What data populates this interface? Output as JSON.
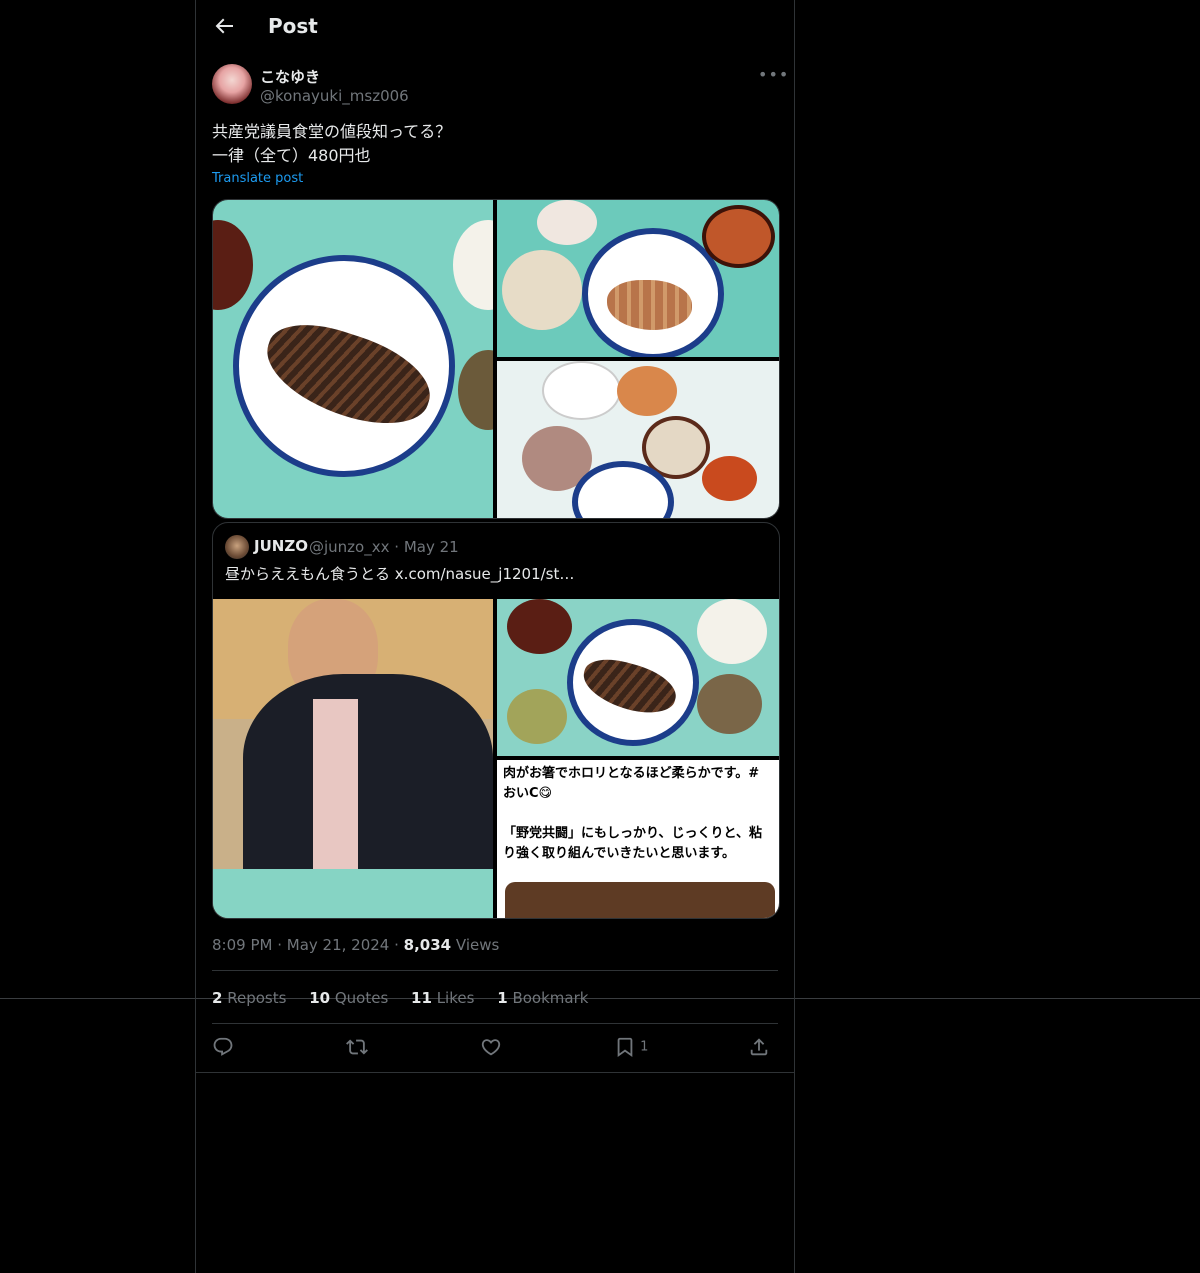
{
  "header": {
    "title": "Post"
  },
  "post": {
    "author_name": "こなゆき",
    "author_handle": "@konayuki_msz006",
    "text": "共産党議員食堂の値段知ってる？\n一律（全て）480円也",
    "translate_label": "Translate post",
    "time": "8:09 PM",
    "date": "May 21, 2024",
    "views_count": "8,034",
    "views_label": "Views",
    "reposts_count": "2",
    "reposts_label": "Reposts",
    "quotes_count": "10",
    "quotes_label": "Quotes",
    "likes_count": "11",
    "likes_label": "Likes",
    "bookmarks_count": "1",
    "bookmarks_label": "Bookmark",
    "bookmark_action_count": "1"
  },
  "quoted": {
    "author_name": "JUNZO",
    "author_handle": "@junzo_xx",
    "date": "May 21",
    "text": "昼からええもん食うとる",
    "link": "x.com/nasue_j1201/st…",
    "caption": "肉がお箸でホロリとなるほど柔らかです。#おいC😋\n\n「野党共闘」にもしっかり、じっくりと、粘り強く取り組んでいきたいと思います。"
  },
  "colors": {
    "accent": "#1d9bf0",
    "muted": "#71767b",
    "text": "#e7e9ea",
    "background": "#000000",
    "border": "#2f3336"
  },
  "icons": [
    "back-arrow-icon",
    "more-icon",
    "reply-icon",
    "repost-icon",
    "like-icon",
    "bookmark-icon",
    "share-icon"
  ]
}
